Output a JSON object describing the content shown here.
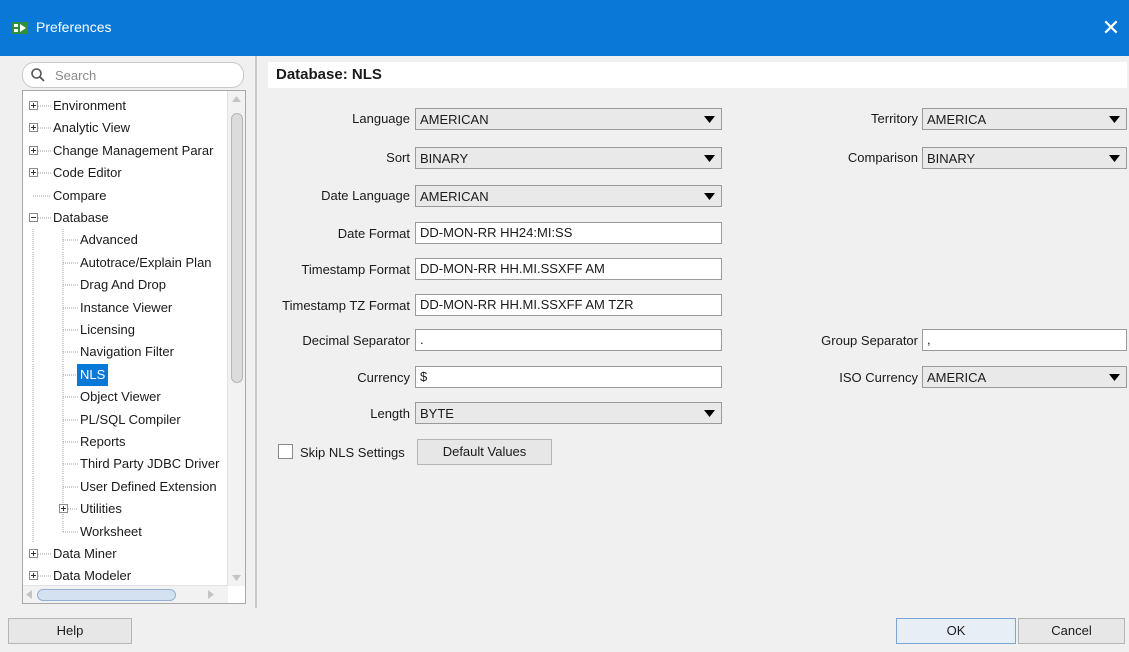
{
  "window": {
    "title": "Preferences"
  },
  "search": {
    "placeholder": "Search"
  },
  "tree": {
    "items": [
      {
        "label": "Environment",
        "expander": "plus"
      },
      {
        "label": "Analytic View",
        "expander": "plus"
      },
      {
        "label": "Change Management Parar",
        "expander": "plus"
      },
      {
        "label": "Code Editor",
        "expander": "plus"
      },
      {
        "label": "Compare",
        "expander": "none"
      },
      {
        "label": "Database",
        "expander": "minus"
      },
      {
        "label": "Advanced",
        "expander": "none"
      },
      {
        "label": "Autotrace/Explain Plan",
        "expander": "none"
      },
      {
        "label": "Drag And Drop",
        "expander": "none"
      },
      {
        "label": "Instance Viewer",
        "expander": "none"
      },
      {
        "label": "Licensing",
        "expander": "none"
      },
      {
        "label": "Navigation Filter",
        "expander": "none"
      },
      {
        "label": "NLS",
        "expander": "none",
        "selected": true
      },
      {
        "label": "Object Viewer",
        "expander": "none"
      },
      {
        "label": "PL/SQL Compiler",
        "expander": "none"
      },
      {
        "label": "Reports",
        "expander": "none"
      },
      {
        "label": "Third Party JDBC Driver",
        "expander": "none"
      },
      {
        "label": "User Defined Extension",
        "expander": "none"
      },
      {
        "label": "Utilities",
        "expander": "plus"
      },
      {
        "label": "Worksheet",
        "expander": "none"
      },
      {
        "label": "Data Miner",
        "expander": "plus"
      },
      {
        "label": "Data Modeler",
        "expander": "plus"
      }
    ]
  },
  "panel": {
    "title": "Database: NLS",
    "language": {
      "label": "Language",
      "value": "AMERICAN"
    },
    "territory": {
      "label": "Territory",
      "value": "AMERICA"
    },
    "sort": {
      "label": "Sort",
      "value": "BINARY"
    },
    "comparison": {
      "label": "Comparison",
      "value": "BINARY"
    },
    "date_language": {
      "label": "Date Language",
      "value": "AMERICAN"
    },
    "date_format": {
      "label": "Date Format",
      "value": "DD-MON-RR HH24:MI:SS"
    },
    "timestamp_format": {
      "label": "Timestamp Format",
      "value": "DD-MON-RR HH.MI.SSXFF AM"
    },
    "timestamp_tz_format": {
      "label": "Timestamp TZ Format",
      "value": "DD-MON-RR HH.MI.SSXFF AM TZR"
    },
    "decimal_separator": {
      "label": "Decimal Separator",
      "value": "."
    },
    "group_separator": {
      "label": "Group Separator",
      "value": ","
    },
    "currency": {
      "label": "Currency",
      "value": "$"
    },
    "iso_currency": {
      "label": "ISO Currency",
      "value": "AMERICA"
    },
    "length": {
      "label": "Length",
      "value": "BYTE"
    },
    "skip_nls": {
      "label": "Skip NLS Settings",
      "checked": false
    },
    "default_values": {
      "label": "Default Values"
    }
  },
  "footer": {
    "help": "Help",
    "ok": "OK",
    "cancel": "Cancel"
  }
}
